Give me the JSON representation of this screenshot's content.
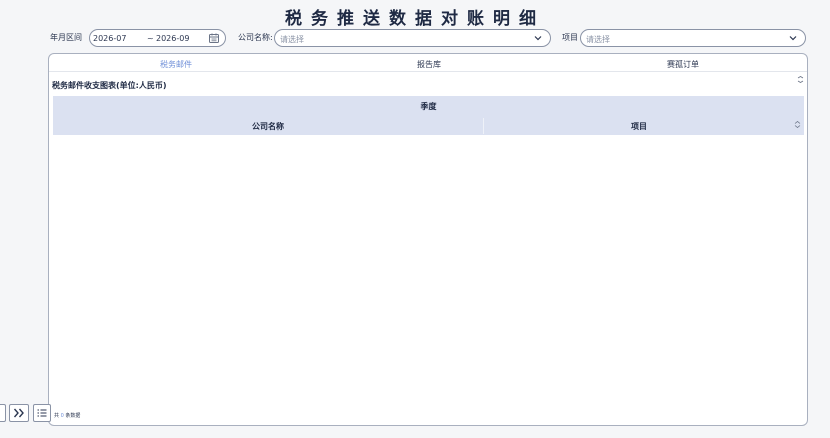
{
  "page": {
    "title": "税务推送数据对账明细"
  },
  "filters": {
    "period_label": "年月区间",
    "period_start": "2026-07",
    "period_sep": "~",
    "period_end": "2026-09",
    "company_label": "公司名称:",
    "company_placeholder": "请选择",
    "project_label": "项目",
    "project_placeholder": "请选择"
  },
  "tabs": [
    {
      "label": "税务邮件",
      "active": true
    },
    {
      "label": "报告库",
      "active": false
    },
    {
      "label": "赛孤订单",
      "active": false
    }
  ],
  "report": {
    "subtitle": "税务邮件收支图表(单位:人民币)",
    "group_header": "季度",
    "columns": [
      "公司名称",
      "项目"
    ],
    "rows": []
  },
  "footer": {
    "prefix": "共",
    "count": "0",
    "suffix": "条数据"
  },
  "colors": {
    "accent": "#6f8fd8",
    "header_bg": "#dbe1f1",
    "text": "#1f2a44"
  },
  "icons": [
    "calendar-icon",
    "chevron-down-icon",
    "double-chevron-right-icon",
    "list-icon",
    "settings-icon",
    "sort-icon"
  ]
}
